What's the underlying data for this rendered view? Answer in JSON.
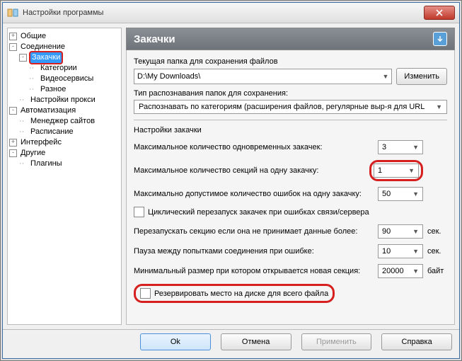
{
  "window": {
    "title": "Настройки программы"
  },
  "tree": {
    "items": [
      {
        "label": "Общие",
        "exp": "+",
        "indent": 0
      },
      {
        "label": "Соединение",
        "exp": "-",
        "indent": 0
      },
      {
        "label": "Закачки",
        "exp": "-",
        "indent": 1,
        "selected": true
      },
      {
        "label": "Категории",
        "exp": "",
        "indent": 2
      },
      {
        "label": "Видеосервисы",
        "exp": "",
        "indent": 2
      },
      {
        "label": "Разное",
        "exp": "",
        "indent": 2
      },
      {
        "label": "Настройки прокси",
        "exp": "",
        "indent": 1
      },
      {
        "label": "Автоматизация",
        "exp": "-",
        "indent": 0
      },
      {
        "label": "Менеджер сайтов",
        "exp": "",
        "indent": 1
      },
      {
        "label": "Расписание",
        "exp": "",
        "indent": 1
      },
      {
        "label": "Интерфейс",
        "exp": "+",
        "indent": 0
      },
      {
        "label": "Другие",
        "exp": "-",
        "indent": 0
      },
      {
        "label": "Плагины",
        "exp": "",
        "indent": 1
      }
    ]
  },
  "panel": {
    "heading": "Закачки",
    "folder_label": "Текущая папка для сохранения файлов",
    "folder_value": "D:\\My Downloads\\",
    "change_btn": "Изменить",
    "recognition_label": "Тип распознавания папок для сохранения:",
    "recognition_value": "Распознавать по категориям (расширения файлов, регулярные выр-я для URL",
    "section_title": "Настройки закачки",
    "max_downloads_label": "Максимальное количество одновременных закачек:",
    "max_downloads_value": "3",
    "max_sections_label": "Максимальное количество секций на одну закачку:",
    "max_sections_value": "1",
    "max_errors_label": "Максимально допустимое количество ошибок на одну закачку:",
    "max_errors_value": "50",
    "cyclic_restart_label": "Циклический перезапуск закачек при ошибках связи/сервера",
    "restart_section_label": "Перезапускать секцию если она не принимает данные более:",
    "restart_section_value": "90",
    "pause_label": "Пауза между попытками соединения при ошибке:",
    "pause_value": "10",
    "min_size_label": "Минимальный размер при котором открывается новая секция:",
    "min_size_value": "20000",
    "reserve_label": "Резервировать место на диске для всего файла",
    "unit_sec": "сек.",
    "unit_byte": "байт"
  },
  "footer": {
    "ok": "Ok",
    "cancel": "Отмена",
    "apply": "Применить",
    "help": "Справка"
  }
}
